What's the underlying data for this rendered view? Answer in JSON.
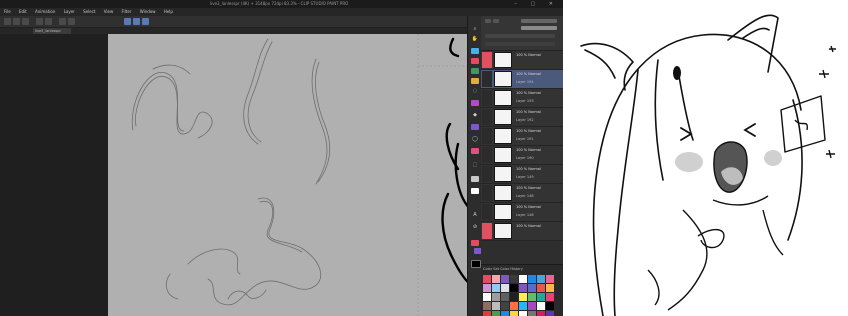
{
  "app": {
    "title": "live3_lanlesspr (4K) + 3148px 72dpi 83.3% - CLIP STUDIO PAINT PRO",
    "window_controls": "– ▢ ✕"
  },
  "menu": {
    "items": [
      "File",
      "Edit",
      "Animation",
      "Layer",
      "Select",
      "View",
      "Filter",
      "Window",
      "Help"
    ]
  },
  "document_tab": {
    "label": "live3_lanlesspr"
  },
  "layers": [
    {
      "mode": "100 % Normal",
      "name": "",
      "selected": false,
      "chip": "red"
    },
    {
      "mode": "100 % Normal",
      "name": "Layer 194",
      "selected": true,
      "chip": "none"
    },
    {
      "mode": "100 % Normal",
      "name": "Layer 193",
      "selected": false,
      "chip": "none"
    },
    {
      "mode": "100 % Normal",
      "name": "Layer 192",
      "selected": false,
      "chip": "none"
    },
    {
      "mode": "100 % Normal",
      "name": "Layer 191",
      "selected": false,
      "chip": "none"
    },
    {
      "mode": "100 % Normal",
      "name": "Layer 190",
      "selected": false,
      "chip": "none"
    },
    {
      "mode": "100 % Normal",
      "name": "Layer 149",
      "selected": false,
      "chip": "none"
    },
    {
      "mode": "100 % Normal",
      "name": "Layer 148",
      "selected": false,
      "chip": "none"
    },
    {
      "mode": "100 % Normal",
      "name": "Layer 146",
      "selected": false,
      "chip": "none"
    },
    {
      "mode": "100 % Normal",
      "name": "",
      "selected": false,
      "chip": "red"
    }
  ],
  "color_panel": {
    "tabs": "Color Set  Color  History",
    "swatches": [
      "#e84a5f",
      "#f4a6b0",
      "#7a5ac8",
      "#3a3a3a",
      "#ffffff",
      "#1e88e5",
      "#4aa3df",
      "#f06292",
      "#ce93d8",
      "#90caf9",
      "#e0e0e0",
      "#000000",
      "#7e57c2",
      "#5c6bc0",
      "#ef5350",
      "#ffb74d",
      "#ffffff",
      "#9e9e9e",
      "#616161",
      "#212121",
      "#ffee58",
      "#66bb6a",
      "#26a69a",
      "#ec407a",
      "#8d6e63",
      "#bdbdbd",
      "#424242",
      "#ff7043",
      "#29b6f6",
      "#ab47bc",
      "#ffffff",
      "#000000",
      "#e53935",
      "#43a047",
      "#1e88e5",
      "#fdd835",
      "#ffffff",
      "#757575",
      "#d81b60",
      "#5e35b1",
      "#f5f5f5",
      "#00acc1"
    ]
  },
  "tools": {
    "icons": [
      "magnifier-icon",
      "hand-icon",
      "pen-icon",
      "pencil-icon",
      "brush-icon",
      "airbrush-icon",
      "eraser-icon",
      "fill-icon",
      "gradient-icon",
      "figure-icon",
      "text-icon",
      "balloon-icon",
      "select-icon",
      "eyedropper-icon"
    ],
    "glyphs": [
      "⌕",
      "✋",
      "✒",
      "✏",
      "✎",
      "◌",
      "▭",
      "◆",
      "▤",
      "◯",
      "A",
      "💬",
      "⬚",
      "⊘"
    ],
    "colors": {
      "main": "#e84a5f",
      "sub": "#7a5ac8",
      "fg": "#000000",
      "bg": "#ffffff"
    }
  },
  "colors": {
    "accent": "#5a79b8",
    "selection": "#4b5a7c"
  }
}
